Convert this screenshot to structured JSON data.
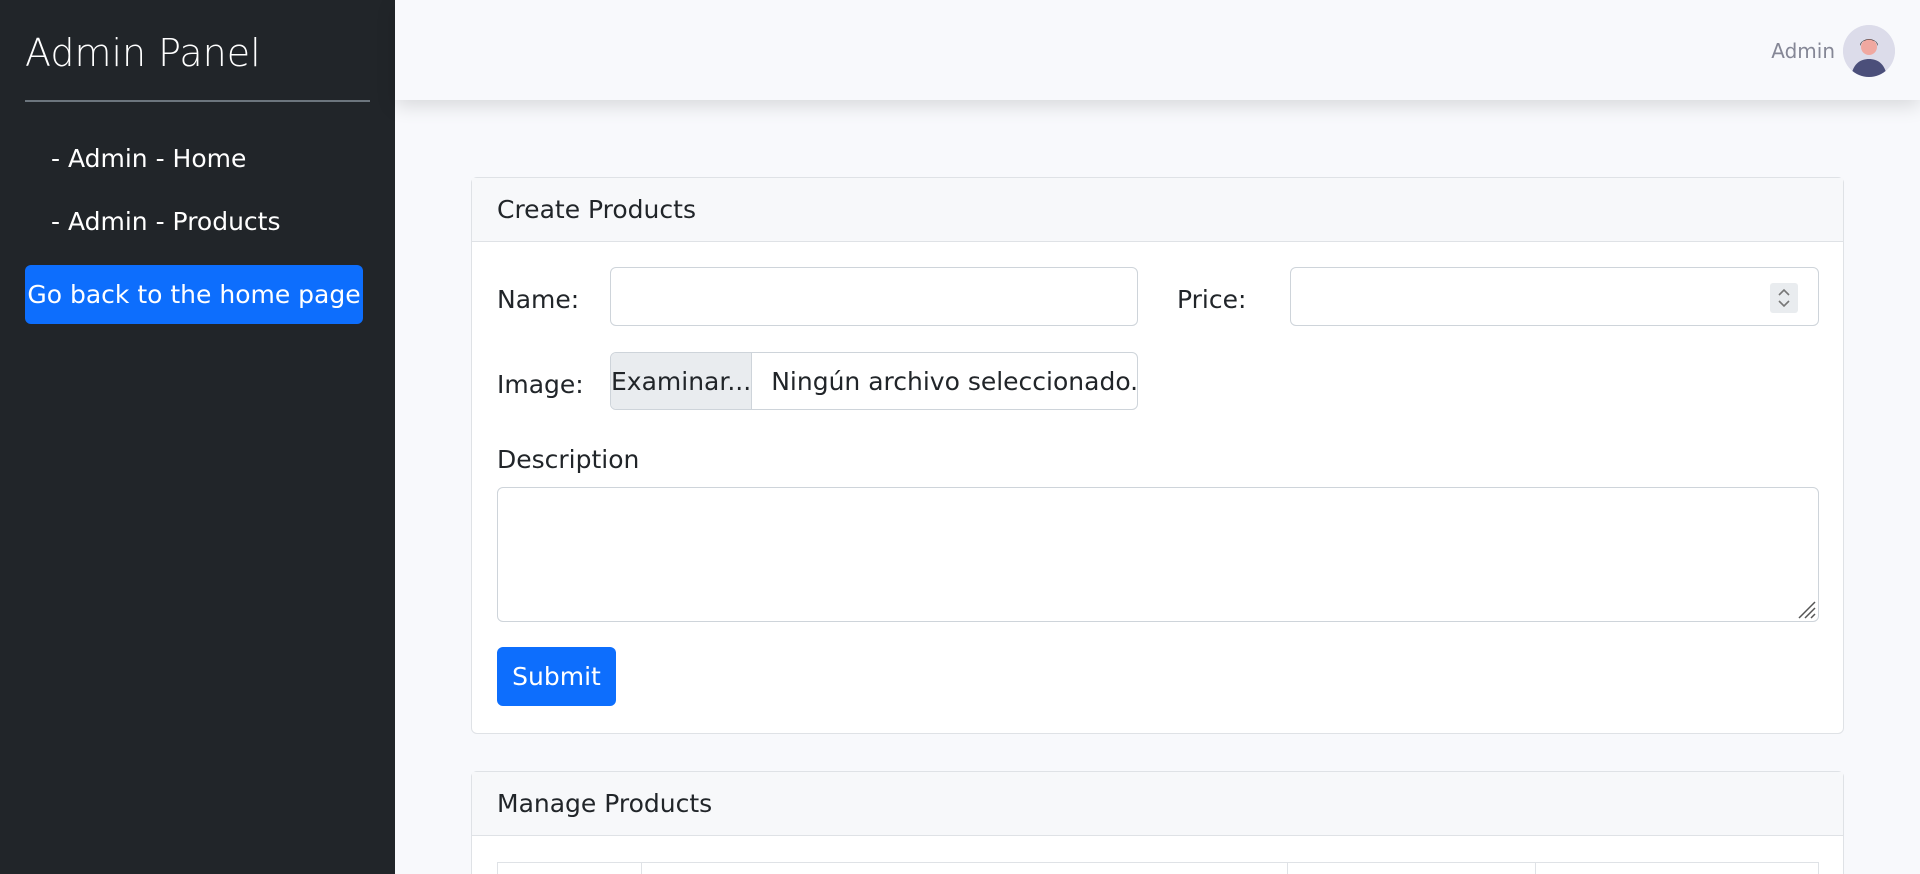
{
  "sidebar": {
    "title": "Admin Panel",
    "links": [
      {
        "label": "- Admin - Home"
      },
      {
        "label": "- Admin - Products"
      }
    ],
    "home_button": "Go back to the home page"
  },
  "topbar": {
    "user_name": "Admin",
    "avatar_icon": "user-avatar-icon"
  },
  "create_card": {
    "title": "Create Products",
    "name_label": "Name:",
    "name_value": "",
    "price_label": "Price:",
    "price_value": "",
    "image_label": "Image:",
    "file_button": "Examinar...",
    "file_status": "Ningún archivo seleccionado.",
    "description_label": "Description",
    "description_value": "",
    "submit_label": "Submit"
  },
  "manage_card": {
    "title": "Manage Products"
  },
  "colors": {
    "sidebar_bg": "#212529",
    "primary": "#0d6efd",
    "page_bg": "#f8f9fc"
  }
}
